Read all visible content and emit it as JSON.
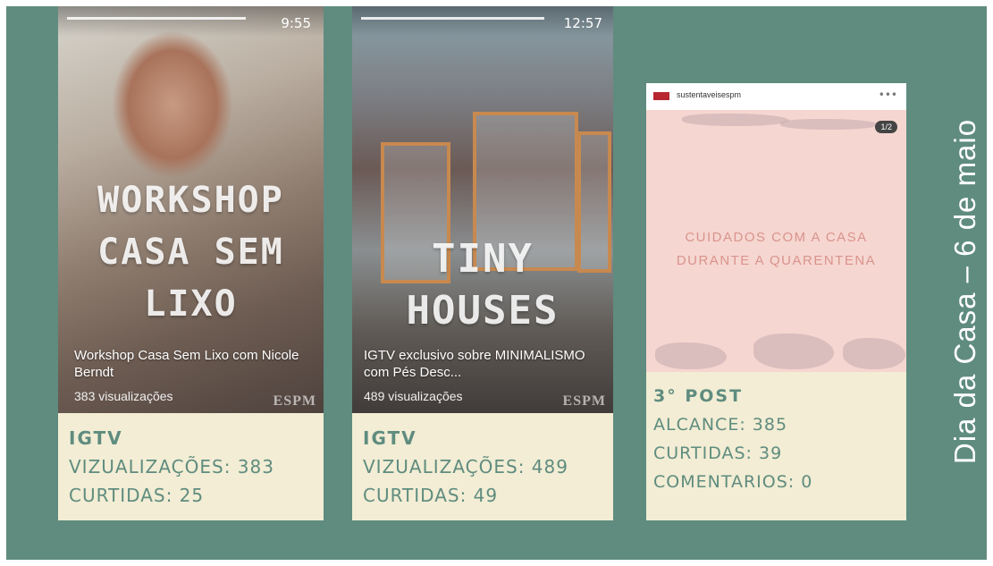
{
  "side_title": "Dia da Casa – 6 de maio",
  "colors": {
    "background": "#5f8c7f",
    "panel": "#f2edd4",
    "stat_text": "#5f8c7f"
  },
  "cards": [
    {
      "time": "9:55",
      "overlay_lines": [
        "WORKSHOP",
        "CASA SEM",
        "LIXO"
      ],
      "caption_title": "Workshop Casa Sem Lixo com Nicole Berndt",
      "caption_views": "383 visualizações",
      "brand": "ESPM",
      "heading": "IGTV",
      "stats": [
        "VIZUALIZAÇÕES: 383",
        "CURTIDAS: 25"
      ]
    },
    {
      "time": "12:57",
      "overlay_lines": [
        "TINY",
        "HOUSES"
      ],
      "caption_title": "IGTV exclusivo sobre MINIMALISMO com Pés Desc...",
      "caption_views": "489 visualizações",
      "brand": "ESPM",
      "heading": "IGTV",
      "stats": [
        "VIZUALIZAÇÕES: 489",
        "CURTIDAS: 49"
      ]
    },
    {
      "username": "sustentaveisespm",
      "counter": "1/2",
      "overlay_lines": [
        "CUIDADOS COM A CASA",
        "DURANTE A QUARENTENA"
      ],
      "heading": "3° POST",
      "stats": [
        "ALCANCE: 385",
        "CURTIDAS: 39",
        "COMENTARIOS: 0"
      ]
    }
  ]
}
